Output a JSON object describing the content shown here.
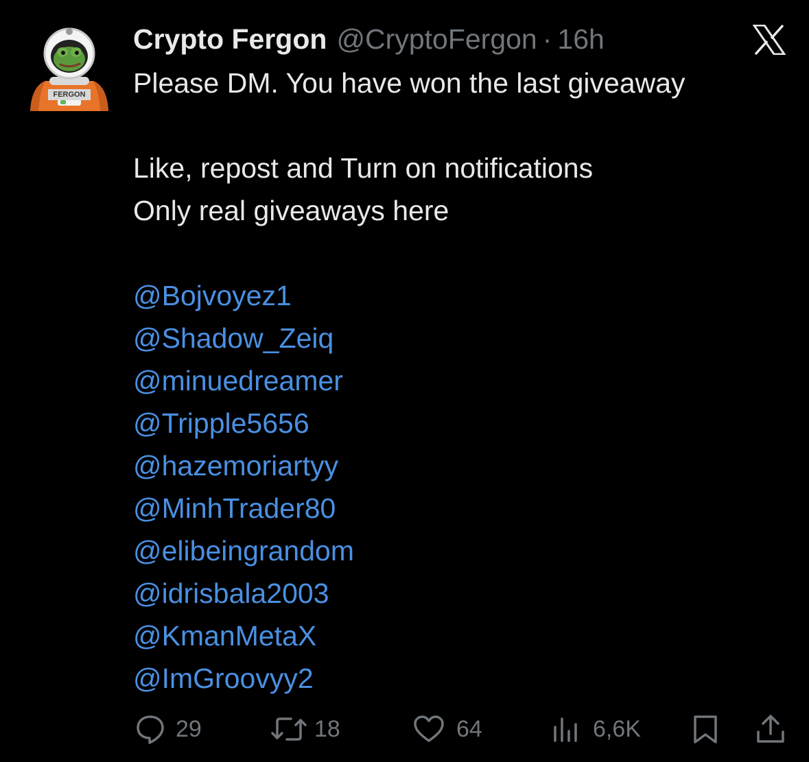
{
  "tweet": {
    "display_name": "Crypto Fergon",
    "handle": "@CryptoFergon",
    "separator": "·",
    "time": "16h",
    "avatar_badge": "FERGON",
    "lines": [
      "Please DM. You have won the last giveaway",
      "",
      "Like, repost and Turn on notifications",
      "Only real giveaways here",
      ""
    ],
    "mentions": [
      "@Bojvoyez1",
      "@Shadow_Zeiq",
      "@minuedreamer",
      "@Tripple5656",
      "@hazemoriartyy",
      "@MinhTrader80",
      "@elibeingrandom",
      "@idrisbala2003",
      "@KmanMetaX",
      "@ImGroovyy2"
    ]
  },
  "actions": {
    "replies": "29",
    "reposts": "18",
    "likes": "64",
    "views": "6,6K"
  },
  "icons": {
    "logo": "x-logo-icon",
    "reply": "reply-icon",
    "repost": "repost-icon",
    "like": "heart-icon",
    "views": "views-chart-icon",
    "bookmark": "bookmark-icon",
    "share": "share-icon"
  },
  "colors": {
    "background": "#000000",
    "text": "#e7e9ea",
    "secondary": "#71767b",
    "mention": "#4a90e2"
  }
}
